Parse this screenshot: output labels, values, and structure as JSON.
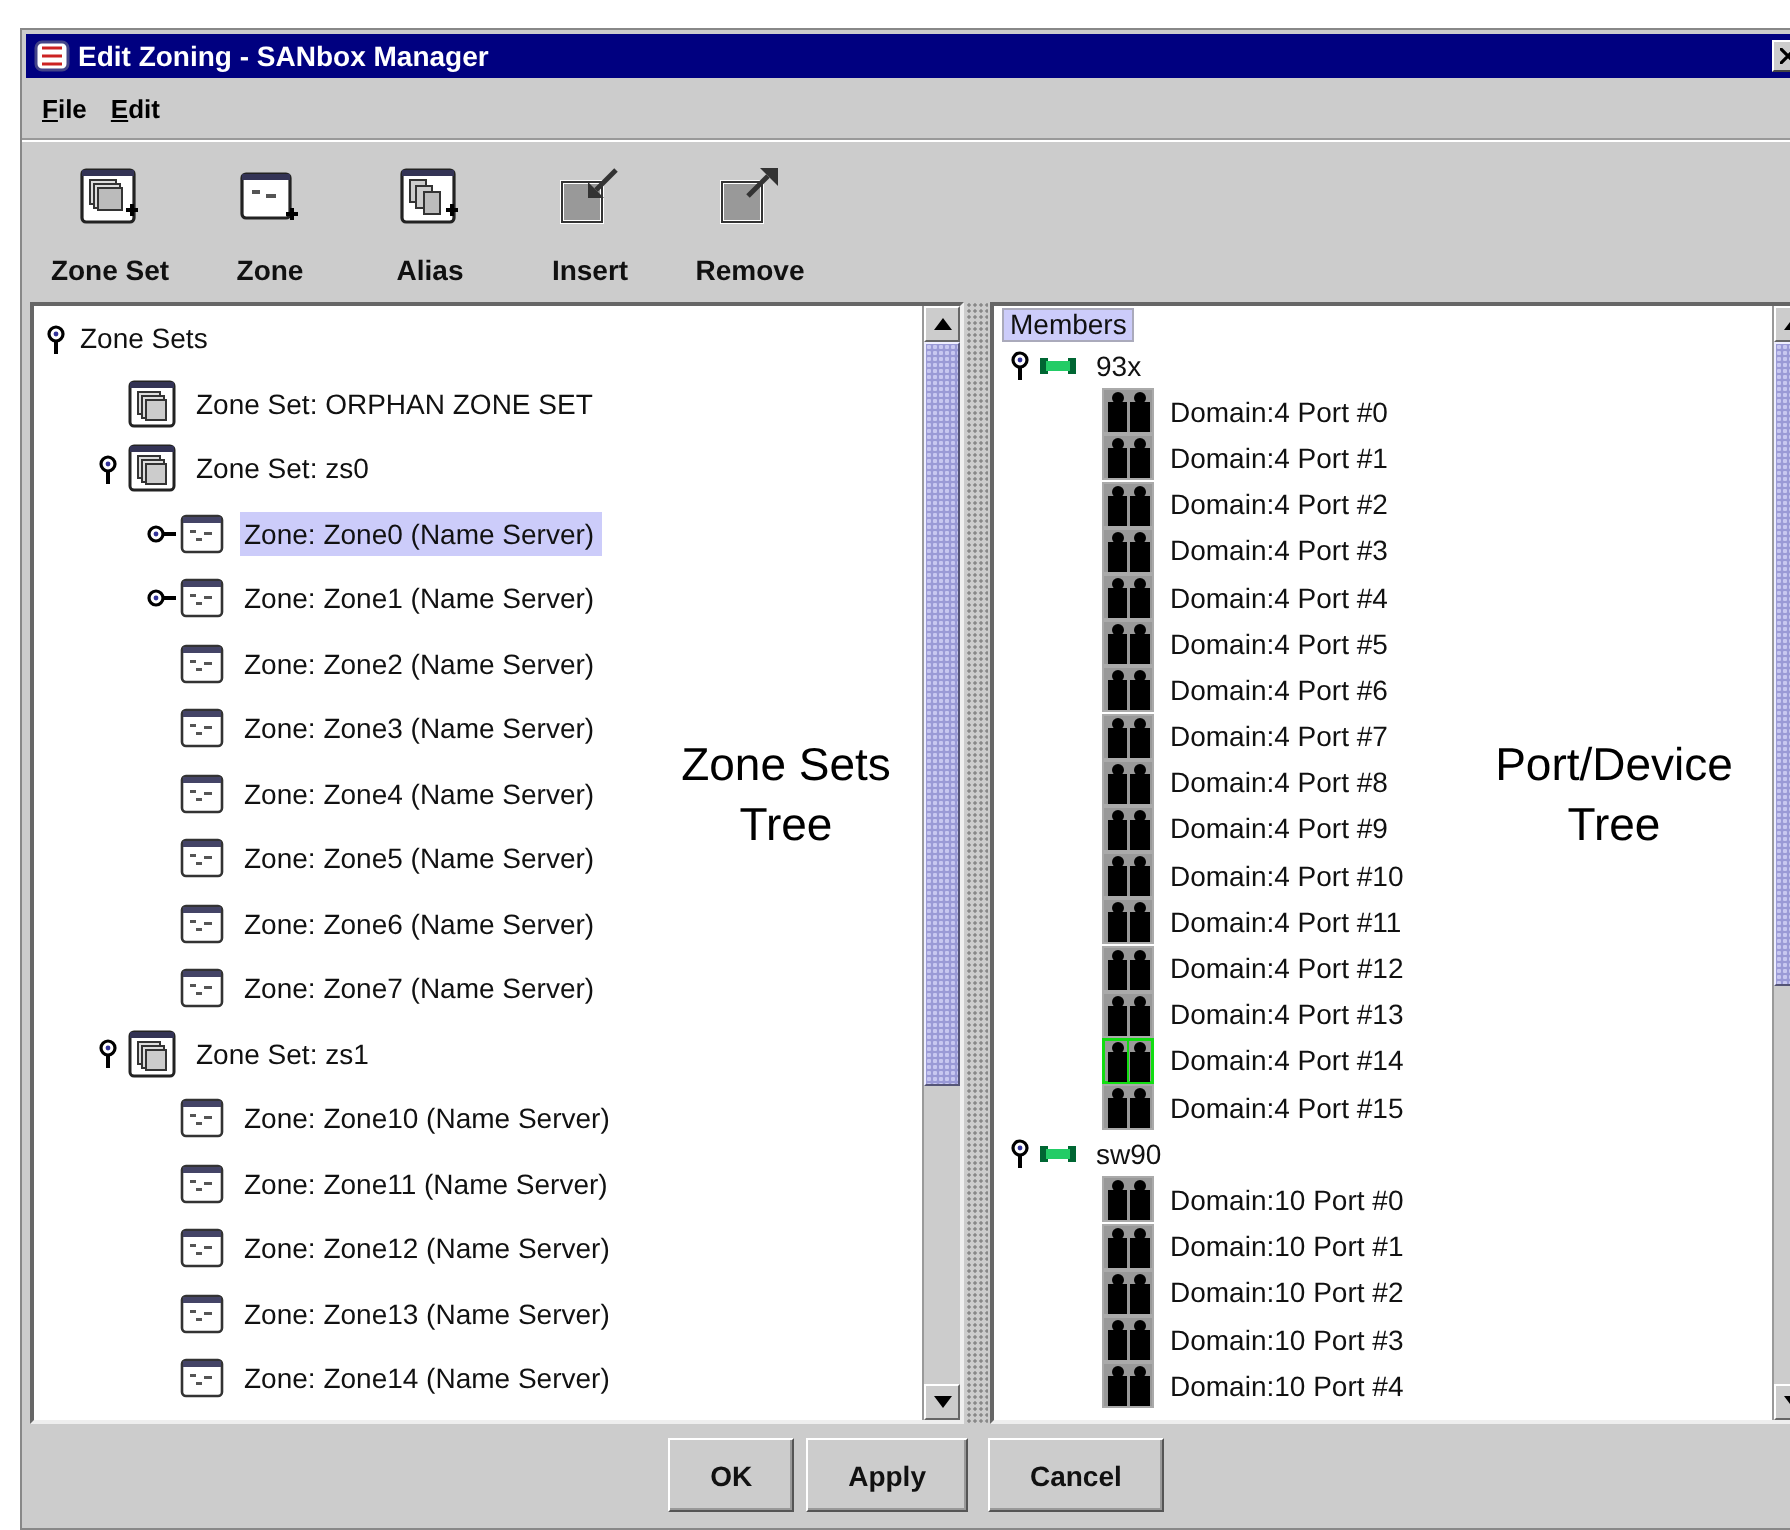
{
  "window": {
    "title": "Edit Zoning - SANbox Manager"
  },
  "menu": [
    {
      "label": "File"
    },
    {
      "label": "Edit"
    }
  ],
  "toolbar": [
    {
      "label": "Zone Set",
      "kind": "zone_set"
    },
    {
      "label": "Zone",
      "kind": "zone"
    },
    {
      "label": "Alias",
      "kind": "alias"
    },
    {
      "label": "Insert",
      "kind": "insert"
    },
    {
      "label": "Remove",
      "kind": "remove"
    }
  ],
  "zone_tree": {
    "nodes": [
      {
        "label": "Zone Sets",
        "expanded": true,
        "selected": false,
        "children": [
          {
            "label": "Zone Set: ORPHAN ZONE SET",
            "kind": "zone_set",
            "selected": false
          },
          {
            "label": "Zone Set: zs0",
            "kind": "zone_set",
            "expanded": true,
            "selected": false,
            "children": [
              {
                "label": "Zone: Zone0 (Name Server)",
                "kind": "zone",
                "expanded": false,
                "selected": true
              },
              {
                "label": "Zone: Zone1 (Name Server)",
                "kind": "zone",
                "expanded": false,
                "selected": false
              },
              {
                "label": "Zone: Zone2 (Name Server)",
                "kind": "zone",
                "selected": false
              },
              {
                "label": "Zone: Zone3 (Name Server)",
                "kind": "zone",
                "selected": false
              },
              {
                "label": "Zone: Zone4 (Name Server)",
                "kind": "zone",
                "selected": false
              },
              {
                "label": "Zone: Zone5 (Name Server)",
                "kind": "zone",
                "selected": false
              },
              {
                "label": "Zone: Zone6 (Name Server)",
                "kind": "zone",
                "selected": false
              },
              {
                "label": "Zone: Zone7 (Name Server)",
                "kind": "zone",
                "selected": false
              }
            ]
          },
          {
            "label": "Zone Set: zs1",
            "kind": "zone_set",
            "expanded": true,
            "selected": false,
            "children": [
              {
                "label": "Zone: Zone10 (Name Server)",
                "kind": "zone",
                "selected": false
              },
              {
                "label": "Zone: Zone11 (Name Server)",
                "kind": "zone",
                "selected": false
              },
              {
                "label": "Zone: Zone12 (Name Server)",
                "kind": "zone",
                "selected": false
              },
              {
                "label": "Zone: Zone13 (Name Server)",
                "kind": "zone",
                "selected": false
              },
              {
                "label": "Zone: Zone14 (Name Server)",
                "kind": "zone",
                "selected": false
              }
            ]
          }
        ]
      }
    ]
  },
  "members_tree": {
    "header": {
      "label": "Members",
      "selected": true
    },
    "nodes": [
      {
        "label": "93x",
        "kind": "switch",
        "expanded": true,
        "selected": false,
        "children": [
          {
            "label": "Domain:4 Port #0",
            "kind": "port",
            "selected": false
          },
          {
            "label": "Domain:4 Port #1",
            "kind": "port",
            "selected": false
          },
          {
            "label": "Domain:4 Port #2",
            "kind": "port",
            "selected": false
          },
          {
            "label": "Domain:4 Port #3",
            "kind": "port",
            "selected": false
          },
          {
            "label": "Domain:4 Port #4",
            "kind": "port",
            "selected": false
          },
          {
            "label": "Domain:4 Port #5",
            "kind": "port",
            "selected": false
          },
          {
            "label": "Domain:4 Port #6",
            "kind": "port",
            "selected": false
          },
          {
            "label": "Domain:4 Port #7",
            "kind": "port",
            "selected": false
          },
          {
            "label": "Domain:4 Port #8",
            "kind": "port",
            "selected": false
          },
          {
            "label": "Domain:4 Port #9",
            "kind": "port",
            "selected": false
          },
          {
            "label": "Domain:4 Port #10",
            "kind": "port",
            "selected": false
          },
          {
            "label": "Domain:4 Port #11",
            "kind": "port",
            "selected": false
          },
          {
            "label": "Domain:4 Port #12",
            "kind": "port",
            "selected": false
          },
          {
            "label": "Domain:4 Port #13",
            "kind": "port",
            "selected": false
          },
          {
            "label": "Domain:4 Port #14",
            "kind": "port",
            "selected": true
          },
          {
            "label": "Domain:4 Port #15",
            "kind": "port",
            "selected": false
          }
        ]
      },
      {
        "label": "sw90",
        "kind": "switch",
        "expanded": true,
        "selected": false,
        "children": [
          {
            "label": "Domain:10 Port #0",
            "kind": "port",
            "selected": false
          },
          {
            "label": "Domain:10 Port #1",
            "kind": "port",
            "selected": false
          },
          {
            "label": "Domain:10 Port #2",
            "kind": "port",
            "selected": false
          },
          {
            "label": "Domain:10 Port #3",
            "kind": "port",
            "selected": false
          },
          {
            "label": "Domain:10 Port #4",
            "kind": "port",
            "selected": false
          }
        ]
      }
    ]
  },
  "annotations": [
    {
      "text": "Zone Sets Tree"
    },
    {
      "text": "Port/Device Tree"
    }
  ],
  "buttons": [
    {
      "label": "OK"
    },
    {
      "label": "Apply"
    },
    {
      "label": "Cancel"
    }
  ]
}
